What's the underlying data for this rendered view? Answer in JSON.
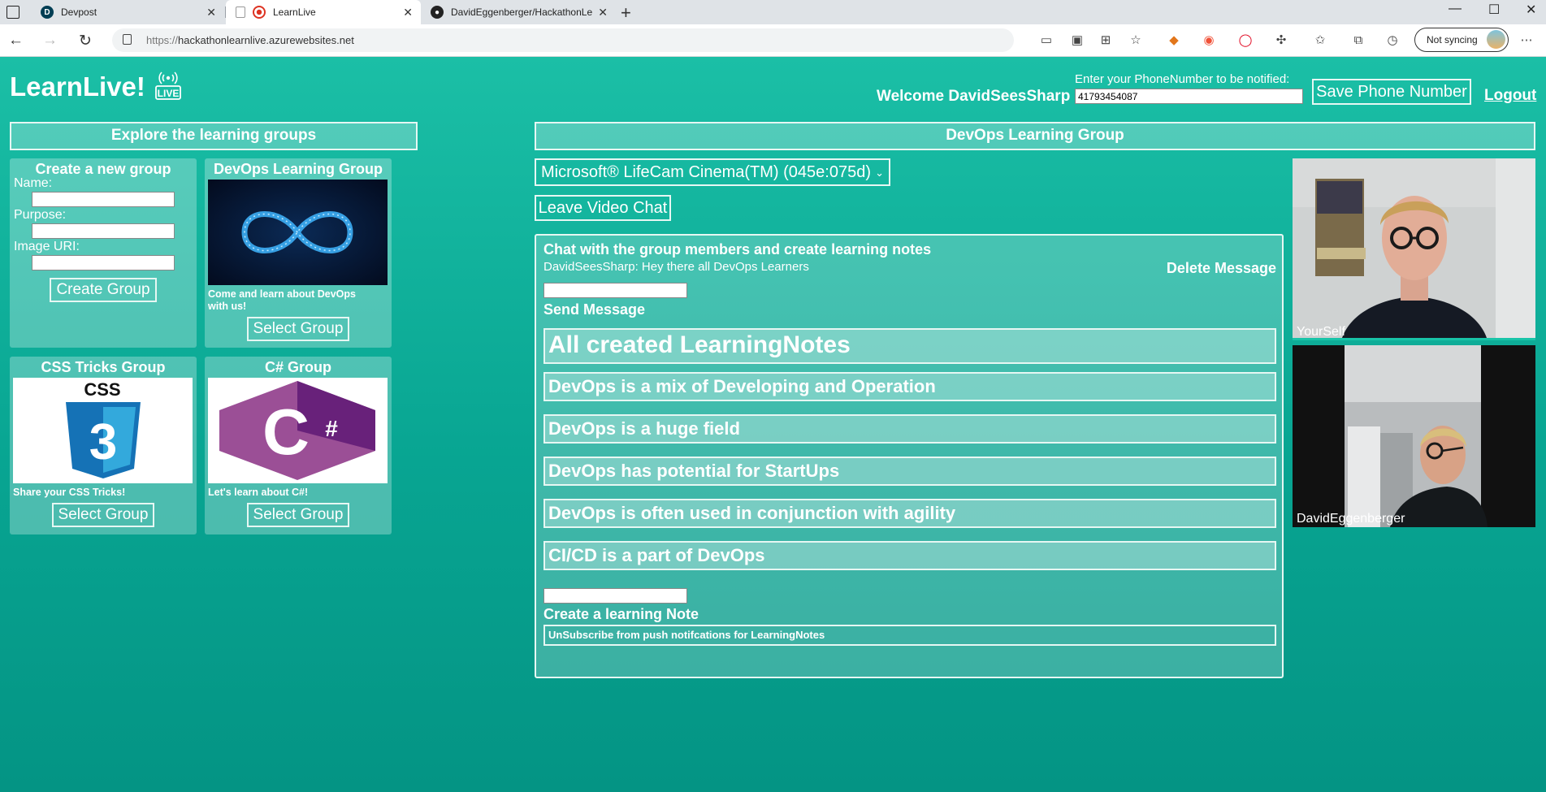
{
  "browser": {
    "tabs": [
      {
        "title": "Devpost",
        "close": "✕"
      },
      {
        "title": "LearnLive",
        "close": "✕"
      },
      {
        "title": "DavidEggenberger/HackathonLe",
        "close": "✕"
      }
    ],
    "new_tab": "+",
    "window_controls": {
      "minimize": "—",
      "maximize": "☐",
      "close": "✕"
    },
    "nav": {
      "back": "←",
      "forward": "→",
      "reload": "↻"
    },
    "url_proto": "https://",
    "url_host": "hackathonlearnlive.azurewebsites.net",
    "sync_label": "Not syncing",
    "more": "⋯"
  },
  "header": {
    "logo": "LearnLive!",
    "live_badge": "LIVE",
    "welcome": "Welcome DavidSeesSharp",
    "phone_label": "Enter your PhoneNumber to be notified:",
    "phone_value": "41793454087",
    "save_phone": "Save Phone Number",
    "logout": "Logout"
  },
  "explore": {
    "title": "Explore the learning groups",
    "create": {
      "title": "Create a new group",
      "name_label": "Name:",
      "purpose_label": "Purpose:",
      "image_label": "Image URI:",
      "button": "Create Group"
    },
    "groups": [
      {
        "title": "DevOps Learning Group",
        "desc": "Come and learn about DevOps with us!",
        "button": "Select Group"
      },
      {
        "title": "CSS Tricks Group",
        "desc": "Share your CSS Tricks!",
        "button": "Select Group"
      },
      {
        "title": "C# Group",
        "desc": "Let's learn about C#!",
        "button": "Select Group"
      }
    ],
    "css_logo": "CSS",
    "css_shield": "3",
    "csharp_logo": "C",
    "csharp_sharp": "#"
  },
  "group": {
    "title": "DevOps Learning Group",
    "camera": "Microsoft® LifeCam Cinema(TM) (045e:075d)",
    "leave": "Leave Video Chat",
    "chat_title": "Chat with the group members and create learning notes",
    "message": "DavidSeesSharp: Hey there all DevOps Learners",
    "delete": "Delete Message",
    "send": "Send Message",
    "notes_header": "All created LearningNotes",
    "notes": [
      "DevOps is a mix of Developing and Operation",
      "DevOps is a huge field",
      "DevOps has potential for StartUps",
      "DevOps is often used in conjunction with agility",
      "CI/CD is a part of DevOps"
    ],
    "create_note": "Create a learning Note",
    "unsubscribe": "UnSubscribe from push notifcations for LearningNotes"
  },
  "videos": [
    {
      "label": "YourSelf"
    },
    {
      "label": "DavidEggenberger"
    }
  ]
}
